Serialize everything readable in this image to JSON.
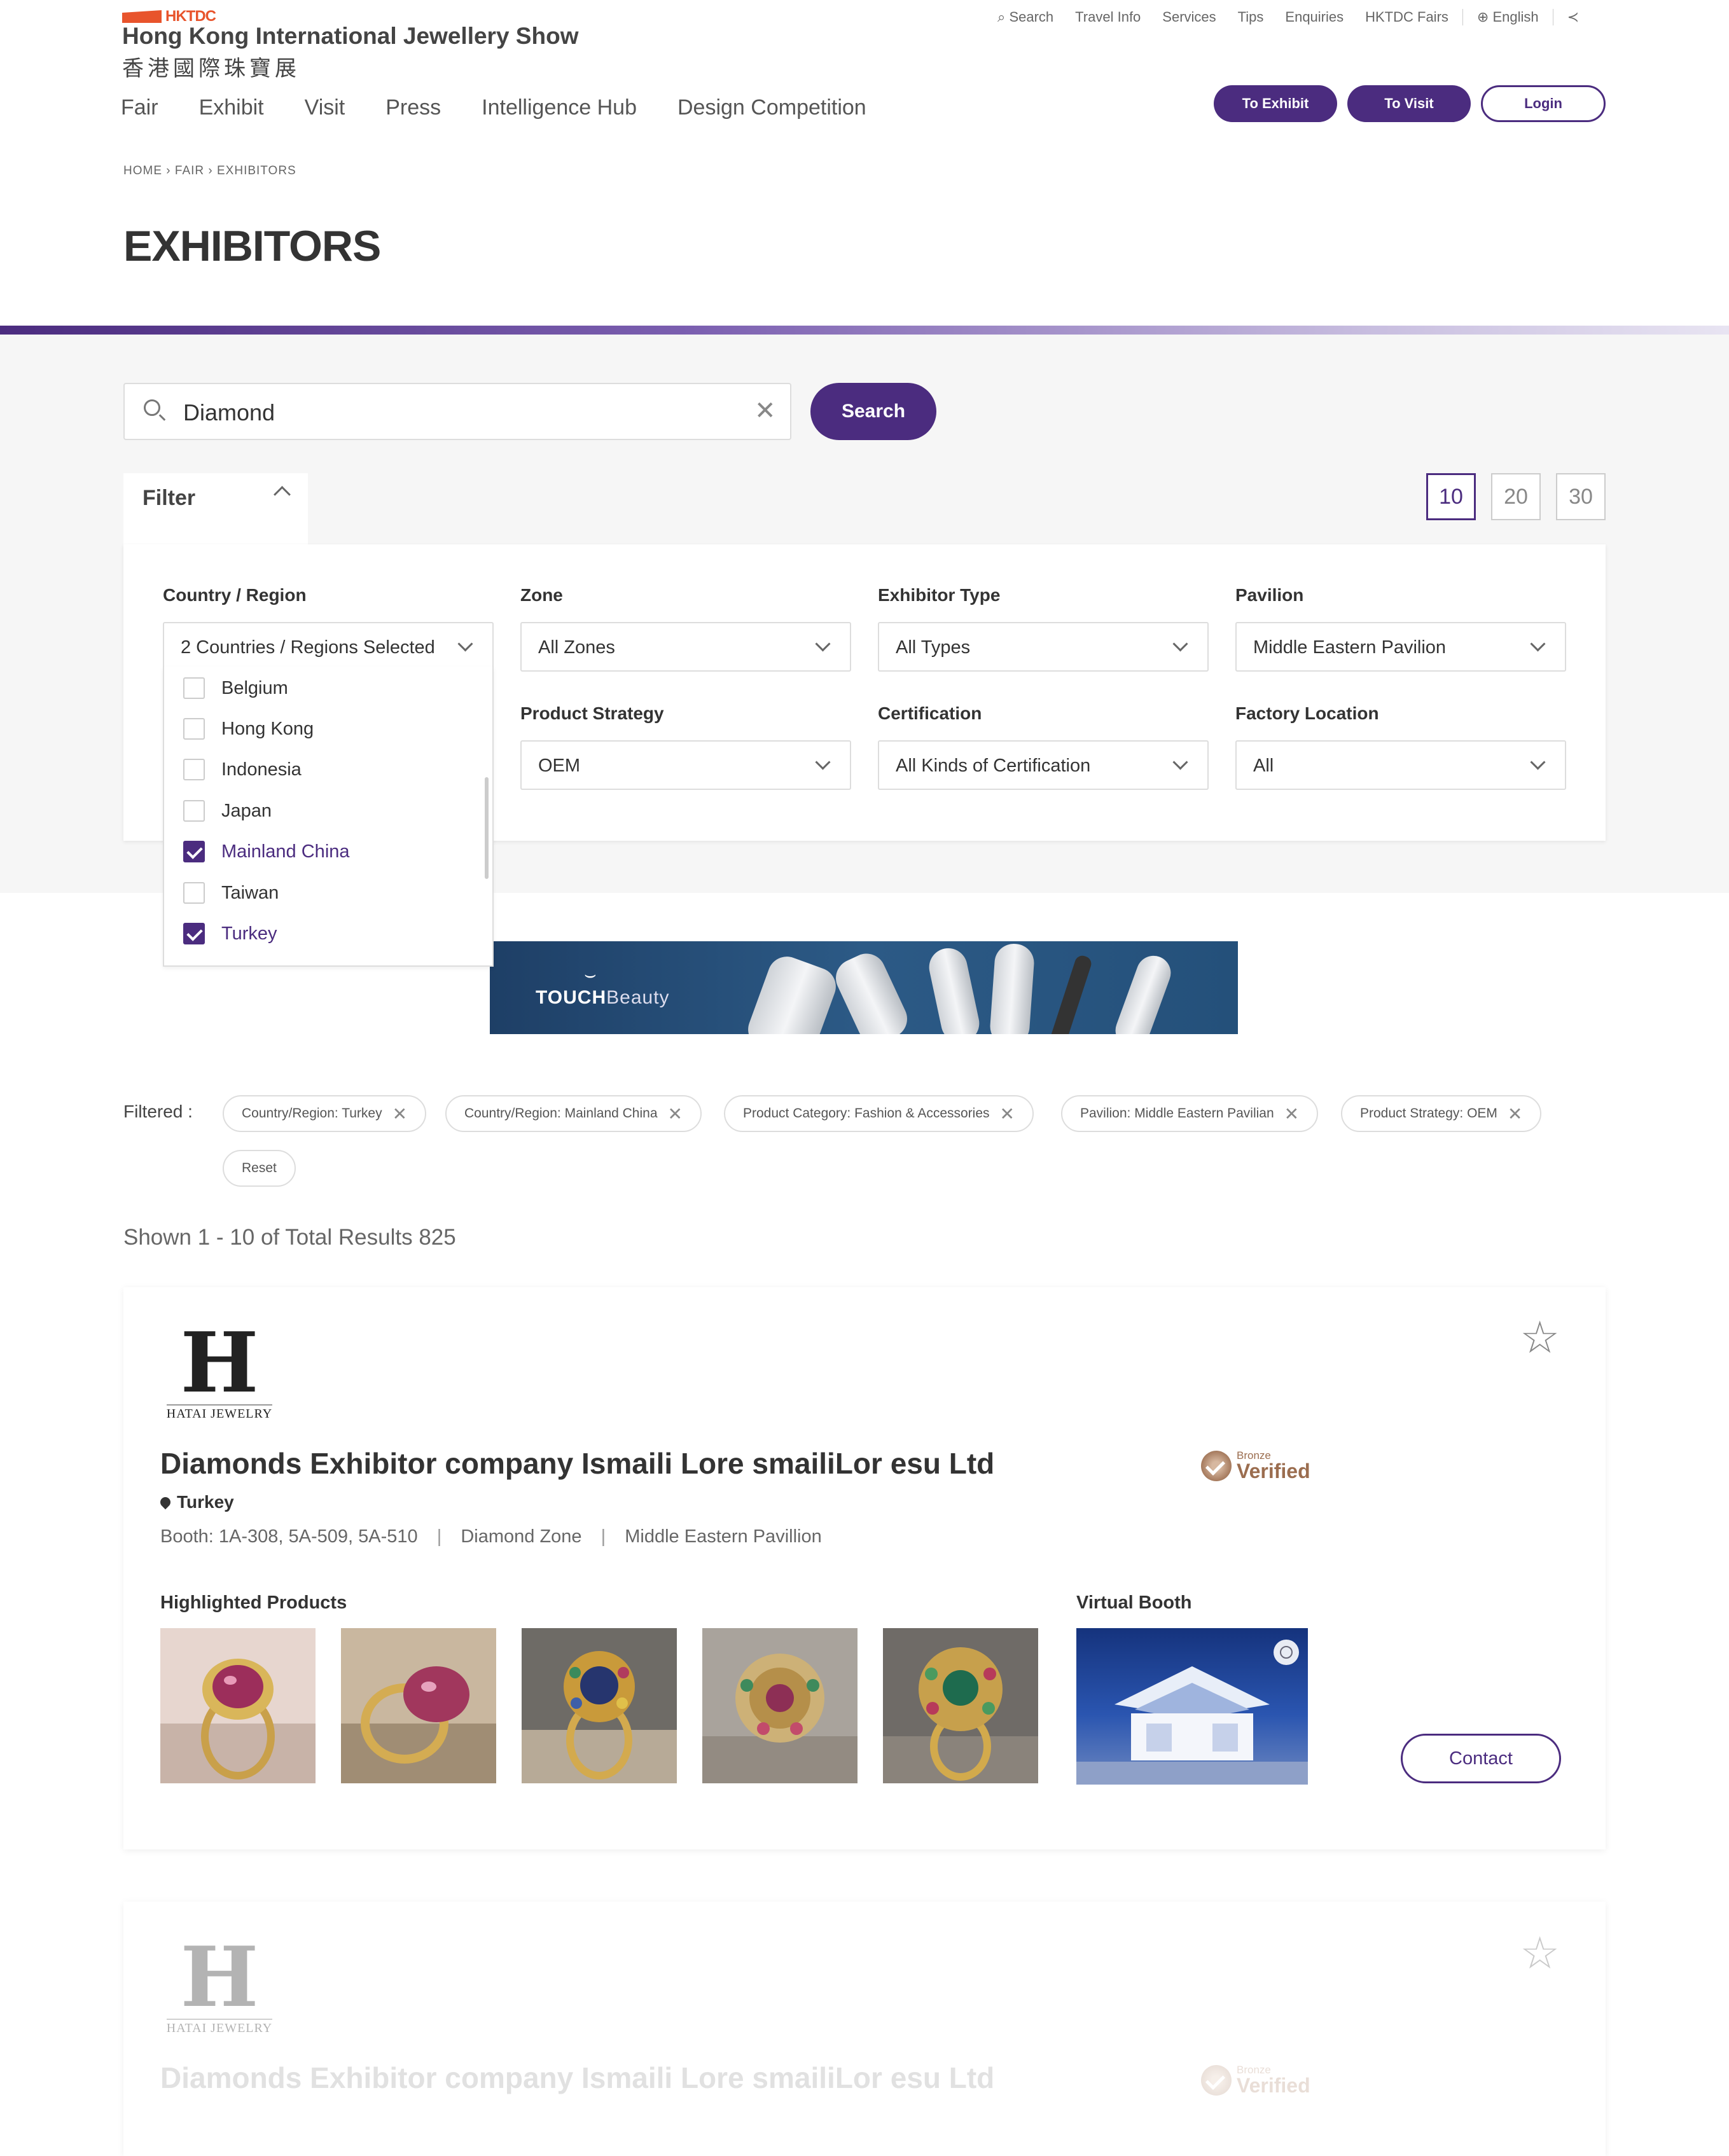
{
  "header": {
    "brand": "HKTDC",
    "show_name_en": "Hong Kong International Jewellery Show",
    "show_name_zh": "香港國際珠寶展",
    "util_nav": [
      "Search",
      "Travel Info",
      "Services",
      "Tips",
      "Enquiries",
      "HKTDC Fairs"
    ],
    "language": "English",
    "main_nav": [
      "Fair",
      "Exhibit",
      "Visit",
      "Press",
      "Intelligence Hub",
      "Design Competition"
    ],
    "btn_exhibit": "To Exhibit",
    "btn_visit": "To Visit",
    "btn_login": "Login"
  },
  "breadcrumb": "HOME › FAIR › EXHIBITORS",
  "page_title": "EXHIBITORS",
  "search": {
    "value": "Diamond",
    "button": "Search"
  },
  "filter": {
    "toggle_label": "Filter",
    "per_page": [
      "10",
      "20",
      "30"
    ],
    "active_per_page": "10",
    "fields": {
      "country": {
        "label": "Country / Region",
        "value": "2 Countries / Regions Selected"
      },
      "zone": {
        "label": "Zone",
        "value": "All Zones"
      },
      "exhibitor_type": {
        "label": "Exhibitor Type",
        "value": "All Types"
      },
      "pavilion": {
        "label": "Pavilion",
        "value": "Middle Eastern Pavilion"
      },
      "product_strategy": {
        "label": "Product Strategy",
        "value": "OEM"
      },
      "certification": {
        "label": "Certification",
        "value": "All Kinds of Certification"
      },
      "factory_location": {
        "label": "Factory Location",
        "value": "All"
      }
    },
    "country_options": [
      {
        "label": "Belgium",
        "checked": false
      },
      {
        "label": "Hong Kong",
        "checked": false
      },
      {
        "label": "Indonesia",
        "checked": false
      },
      {
        "label": "Japan",
        "checked": false
      },
      {
        "label": "Mainland China",
        "checked": true
      },
      {
        "label": "Taiwan",
        "checked": false
      },
      {
        "label": "Turkey",
        "checked": true
      }
    ]
  },
  "banner": {
    "brand_bold": "TOUCH",
    "brand_light": "Beauty"
  },
  "filtered": {
    "label": "Filtered :",
    "chips": [
      "Country/Region: Turkey",
      "Country/Region: Mainland China",
      "Product Category: Fashion & Accessories",
      "Pavilion: Middle Eastern Pavilian",
      "Product Strategy: OEM"
    ],
    "reset": "Reset"
  },
  "results_info": "Shown 1 - 10 of Total Results 825",
  "exhibitors": [
    {
      "logo_letter": "H",
      "logo_text": "HATAI JEWELRY",
      "name": "Diamonds Exhibitor company Ismaili Lore smailiLor esu Ltd",
      "country": "Turkey",
      "booth": "Booth: 1A-308, 5A-509, 5A-510",
      "zone": "Diamond Zone",
      "pavilion": "Middle Eastern Pavillion",
      "badge_small": "Bronze",
      "badge_big": "Verified",
      "highlighted_label": "Highlighted Products",
      "virtual_booth_label": "Virtual Booth",
      "contact": "Contact"
    },
    {
      "logo_letter": "H",
      "logo_text": "HATAI JEWELRY",
      "name": "Diamonds Exhibitor company Ismaili Lore smailiLor esu Ltd",
      "badge_small": "Bronze",
      "badge_big": "Verified"
    }
  ],
  "colors": {
    "brand_purple": "#4b2c7f",
    "hktdc_red": "#e8542c",
    "bronze": "#9b6d4f"
  }
}
